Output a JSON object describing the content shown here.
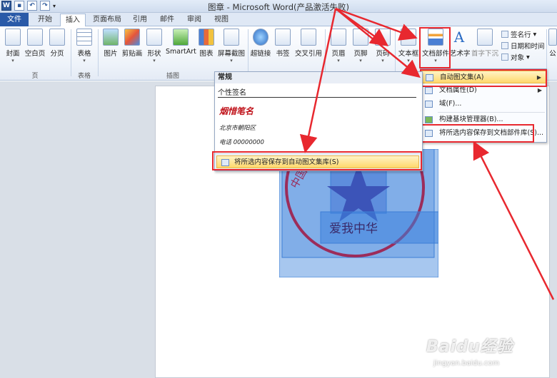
{
  "window": {
    "title": "图章 - Microsoft Word(产品激活失败)",
    "app_icon": "W"
  },
  "tabs": [
    {
      "label": "文件"
    },
    {
      "label": "开始"
    },
    {
      "label": "插入"
    },
    {
      "label": "页面布局"
    },
    {
      "label": "引用"
    },
    {
      "label": "邮件"
    },
    {
      "label": "审阅"
    },
    {
      "label": "视图"
    }
  ],
  "ribbon": {
    "buttons": {
      "cover": "封面",
      "blank_page": "空白页",
      "page_break": "分页",
      "table": "表格",
      "picture": "图片",
      "clipart": "剪贴画",
      "shapes": "形状",
      "smartart": "SmartArt",
      "chart": "图表",
      "screenshot": "屏幕截图",
      "hyperlink": "超链接",
      "bookmark": "书签",
      "cross_ref": "交叉引用",
      "header": "页眉",
      "footer": "页脚",
      "page_number": "页码",
      "textbox": "文本框",
      "quick_parts": "文档部件",
      "wordart": "艺术字",
      "dropcap": "首字下沉",
      "signature_line": "签名行",
      "date_time": "日期和时间",
      "object": "对象",
      "equation": "公"
    },
    "groups": {
      "pages": "页",
      "tables": "表格",
      "illustrations": "插图"
    }
  },
  "quick_parts_menu": {
    "items": [
      {
        "label": "自动图文集(A)",
        "submenu": true
      },
      {
        "label": "文档属性(D)",
        "submenu": true
      },
      {
        "label": "域(F)..."
      },
      {
        "label": "构建基块管理器(B)..."
      },
      {
        "label": "将所选内容保存到文档部件库(S)..."
      }
    ]
  },
  "autotext_gallery": {
    "header": "常规",
    "entry_name": "个性签名",
    "preview_signature": "烟惜笔名",
    "preview_address": "北京市朝阳区",
    "preview_phone": "电话 00000000",
    "save_label": "将所选内容保存到自动图文集库(S)"
  },
  "seal": {
    "bottom_text": "爱我中华",
    "ring_text": "中国"
  },
  "watermark": {
    "main": "Baidu经验",
    "sub": "jingyan.baidu.com"
  },
  "colors": {
    "accent_red": "#e8282f",
    "seal_red": "#c0141c",
    "selection_blue": "#3d7fd6",
    "file_tab": "#2a5aa8"
  }
}
